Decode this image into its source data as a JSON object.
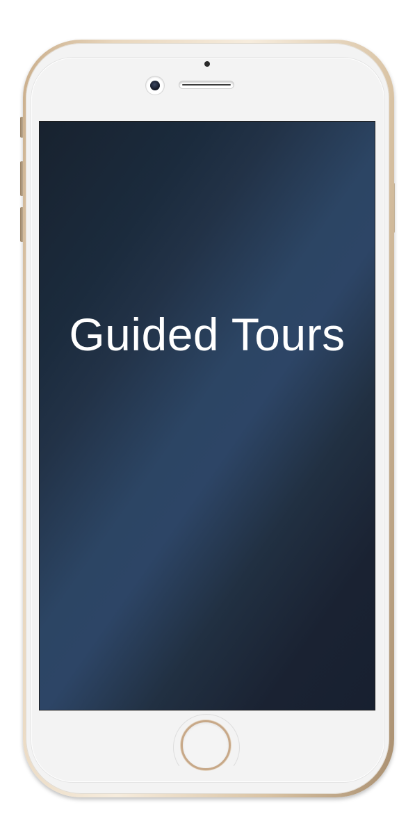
{
  "device": {
    "frame_color": "#d9c3a4",
    "front_color": "#f3f3f3",
    "screen_color": "#2c4564"
  },
  "screen": {
    "title": "Guided Tours",
    "title_color": "#ffffff"
  },
  "icons": {
    "front_camera": "camera-icon",
    "speaker": "speaker-grille",
    "home": "home-button"
  }
}
